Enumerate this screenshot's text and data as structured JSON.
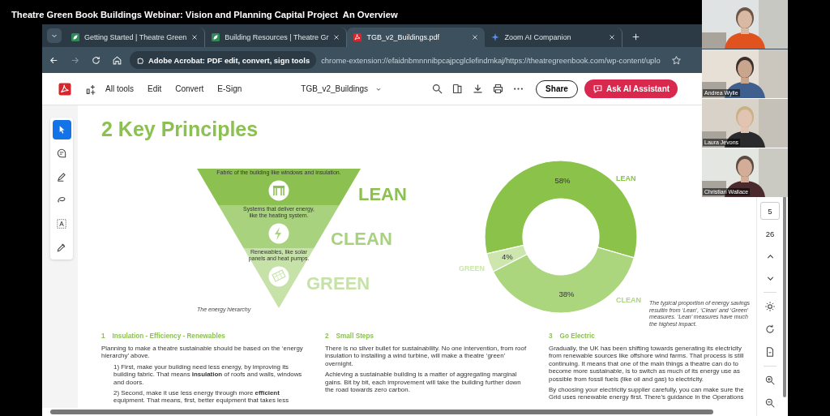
{
  "meeting_title": "Theatre Green Book Buildings Webinar: Vision and Planning Capital Project  An Overview",
  "participants": [
    {
      "kind": "picture"
    },
    {
      "kind": "picture",
      "name": "Andrea Wylie"
    },
    {
      "kind": "picture",
      "name": "Laura Jevons"
    },
    {
      "kind": "picture",
      "name": "Christian Wallace"
    }
  ],
  "browser": {
    "tabs": [
      {
        "title": "Getting Started | Theatre Green",
        "kind": "site",
        "selected": false
      },
      {
        "title": "Building Resources | Theatre Gr",
        "kind": "site",
        "selected": false
      },
      {
        "title": "TGB_v2_Buildings.pdf",
        "kind": "pdf",
        "selected": true
      },
      {
        "title": "Zoom AI Companion",
        "kind": "assistant",
        "selected": false
      }
    ],
    "nav_buttons": [
      {
        "kind": "back",
        "disabled": false
      },
      {
        "kind": "forward",
        "disabled": true
      },
      {
        "kind": "reload",
        "disabled": false
      },
      {
        "kind": "home",
        "disabled": false
      }
    ],
    "site_chip": "Adobe Acrobat: PDF edit, convert, sign tools",
    "url": "chrome-extension://efaidnbmnnnibpcajpcglclefindmkaj/https://theatregreenbook.com/wp-content/uplo"
  },
  "acrobat": {
    "menu": [
      "All tools",
      "Edit",
      "Convert",
      "E-Sign"
    ],
    "document_name": "TGB_v2_Buildings",
    "share_button": "Share",
    "ai_button": "Ask AI Assistant",
    "tools": [
      {
        "kind": "select",
        "selected": true
      },
      {
        "kind": "comment",
        "selected": false
      },
      {
        "kind": "draw",
        "selected": false
      },
      {
        "kind": "lasso",
        "selected": false
      },
      {
        "kind": "text-select",
        "selected": false
      },
      {
        "kind": "sign",
        "selected": false
      }
    ],
    "page_number": "5",
    "page_count": "26"
  },
  "page": {
    "heading": "2 Key Principles",
    "hierarchy": {
      "levels": [
        {
          "label": "LEAN",
          "kind": "fabric",
          "color": "#8cc152",
          "description_lines": [
            "Fabric of the building like windows and insulation."
          ]
        },
        {
          "label": "CLEAN",
          "kind": "systems",
          "color": "#a9d27f",
          "description_lines": [
            "Systems that deliver energy,",
            "like the heating system."
          ]
        },
        {
          "label": "GREEN",
          "kind": "renewables",
          "color": "#c6e2a8",
          "description_lines": [
            "Renewables, like solar",
            "panels and heat pumps."
          ]
        }
      ],
      "caption": "The energy hierarchy"
    },
    "chart_data": {
      "type": "donut",
      "categories": [
        "LEAN",
        "CLEAN",
        "GREEN"
      ],
      "values": [
        58,
        38,
        4
      ],
      "colors": [
        "#8bc34a",
        "#acd67e",
        "#cce6ae"
      ],
      "value_labels": [
        "58%",
        "38%",
        "4%"
      ]
    },
    "chart_caption": "The typical proportion of energy savings resultin from ‘Lean’, ‘Clean’ and ‘Green’ measures. ‘Lean’ measures have much the highest impact.",
    "sections": [
      {
        "number": "1",
        "title": "Insulation - Efficiency - Renewables",
        "paragraphs": [
          {
            "kind": "body",
            "text": "Planning to make a theatre sustainable should be based on the ‘energy hierarchy’ above."
          },
          {
            "kind": "step",
            "text": "1) First, make your building need less energy, by improving its building fabric. That means **insulation** of roofs and walls, windows and doors."
          },
          {
            "kind": "step",
            "text": "2) Second, make it use less energy through more **efficient** equipment. That means, first, better equipment that takes less"
          }
        ]
      },
      {
        "number": "2",
        "title": "Small Steps",
        "paragraphs": [
          {
            "kind": "body",
            "text": "There is no silver bullet for sustainability. No one intervention, from roof insulation to installing a wind turbine, will make a theatre ‘green’ overnight."
          },
          {
            "kind": "body",
            "text": "Achieving a sustainable building is a matter of aggregating marginal gains. Bit by bit, each improvement will take the building further down the road towards zero carbon."
          }
        ]
      },
      {
        "number": "3",
        "title": "Go Electric",
        "paragraphs": [
          {
            "kind": "body",
            "text": "Gradually, the UK has been shifting towards generating its electricity from renewable sources like offshore wind farms. That process is still continuing. It means that one of the main things a theatre can do to become more sustainable, is to switch as much of its energy use as possible from fossil fuels (like oil and gas) to electricity."
          },
          {
            "kind": "body",
            "text": "By choosing your electricity supplier carefully, you can make sure the Grid uses renewable energy first. There’s guidance in the Operations"
          }
        ]
      }
    ]
  }
}
